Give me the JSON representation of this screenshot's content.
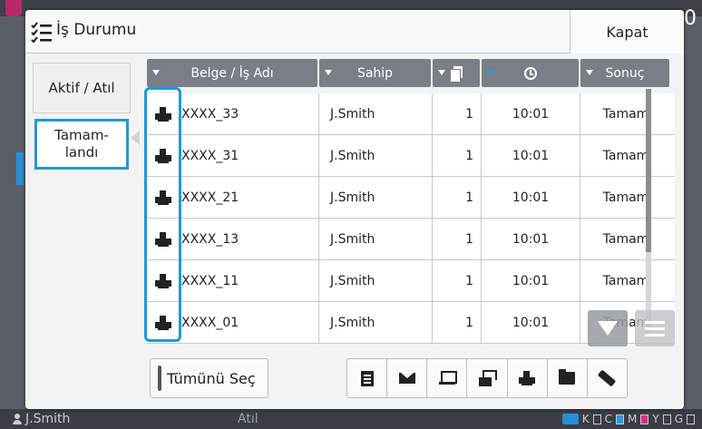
{
  "device": {
    "user": "J.Smith",
    "status": "Atıl",
    "toner_labels": [
      "K",
      "C",
      "M",
      "Y",
      "G"
    ],
    "right_char": "0"
  },
  "dialog": {
    "title": "İş Durumu",
    "title_icon": "checklist-icon",
    "close_label": "Kapat"
  },
  "tabs": {
    "active_jobs": "Aktif / Atıl",
    "completed": "Tamam-\nlandı"
  },
  "table": {
    "columns": {
      "name": "Belge / İş Adı",
      "owner": "Sahip",
      "copies_icon": "copies-icon",
      "time_icon": "clock-icon",
      "result": "Sonuç"
    },
    "rows": [
      {
        "icon": "printer-icon",
        "name": "XXXX_33",
        "owner": "J.Smith",
        "copies": "1",
        "time": "10:01",
        "result": "Tamam"
      },
      {
        "icon": "printer-icon",
        "name": "XXXX_31",
        "owner": "J.Smith",
        "copies": "1",
        "time": "10:01",
        "result": "Tamam"
      },
      {
        "icon": "printer-icon",
        "name": "XXXX_21",
        "owner": "J.Smith",
        "copies": "1",
        "time": "10:01",
        "result": "Tamam"
      },
      {
        "icon": "printer-icon",
        "name": "XXXX_13",
        "owner": "J.Smith",
        "copies": "1",
        "time": "10:01",
        "result": "Tamam"
      },
      {
        "icon": "printer-icon",
        "name": "XXXX_11",
        "owner": "J.Smith",
        "copies": "1",
        "time": "10:01",
        "result": "Tamam"
      },
      {
        "icon": "printer-icon",
        "name": "XXXX_01",
        "owner": "J.Smith",
        "copies": "1",
        "time": "10:01",
        "result": "Tamam"
      }
    ]
  },
  "toolbar": {
    "select_all": "Tümünü Seç",
    "tools": [
      "document-icon",
      "mail-icon",
      "computer-icon",
      "fax-icon",
      "printer-icon",
      "folder-icon",
      "eraser-icon"
    ]
  },
  "colors": {
    "accent": "#1d9ad6",
    "header": "#7a7e86"
  }
}
